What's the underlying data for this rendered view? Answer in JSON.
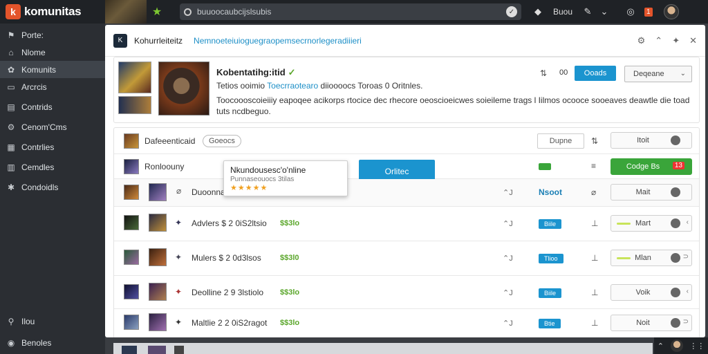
{
  "app": {
    "logo_letter": "k",
    "name": "komunitas"
  },
  "search": {
    "value": "buuoocaubcijslsubis",
    "clear": "✓"
  },
  "top_actions": [
    {
      "icon": "shield-icon",
      "glyph": "◆"
    },
    {
      "label": "Buou"
    },
    {
      "icon": "edit-icon",
      "glyph": "✎"
    },
    {
      "icon": "chevron-down-icon",
      "glyph": "⌄"
    },
    {
      "icon": "bell-icon",
      "glyph": "◎"
    }
  ],
  "notification_count": "1",
  "sidebar": {
    "items": [
      {
        "icon": "fire-icon",
        "glyph": "⚑",
        "label": "Porte:"
      },
      {
        "icon": "home-icon",
        "glyph": "⌂",
        "label": "Nlome"
      },
      {
        "icon": "community-icon",
        "glyph": "✿",
        "label": "Komunits"
      },
      {
        "icon": "archive-icon",
        "glyph": "▭",
        "label": "Arcrcis"
      },
      {
        "icon": "controls-icon",
        "glyph": "▤",
        "label": "Contrids"
      },
      {
        "icon": "games-icon",
        "glyph": "⚙",
        "label": "Cenom'Cms"
      },
      {
        "icon": "calendar-icon",
        "glyph": "▦",
        "label": "Contrlies"
      },
      {
        "icon": "templates-icon",
        "glyph": "▥",
        "label": "Cemdles"
      },
      {
        "icon": "settings-icon",
        "glyph": "✱",
        "label": "Condoidls"
      }
    ],
    "bottom": [
      {
        "icon": "pin-icon",
        "glyph": "⚲",
        "label": "Ilou"
      },
      {
        "icon": "help-icon",
        "glyph": "◉",
        "label": "Benoles"
      }
    ]
  },
  "panel": {
    "icon_text": "K",
    "title": "Kohurrleiteitz",
    "subtitle": "Nemnoeteiuioguegraopemsecrnorlegeradiiieri",
    "actions": [
      "⚙",
      "⌃",
      "✦",
      "✕"
    ]
  },
  "feature": {
    "title": "Kobentatihg:itid",
    "title_mark": "✓",
    "meta_prefix": "Tetios ooimio",
    "meta_link": "Toecrraotearo",
    "meta_rest": "diioooocs Toroas 0 Oritnles.",
    "description": "Toocoooscoieiiiy eapoqee acikorps rtocice dec rhecore oeoscioeicwes soieileme trags l Iilmos ocooce sooeaves deawtle die toad tuts ncdbeguo.",
    "share_glyph": "⇅",
    "count": "00",
    "primary_button": "Ooads",
    "dropdown_value": "Deqeane"
  },
  "rows": [
    {
      "name": "Dafeeenticaid",
      "pill": "Goeocs",
      "input": "Dupne",
      "action": "⇅",
      "toggle": "Itoit"
    },
    {
      "name": "Ronloouny",
      "toggle": "Codge Bs",
      "toggle_tail": "13",
      "action": "≡",
      "online_button": "Orlitec"
    },
    {
      "name": "Duoonnasadoi",
      "num": "⌃J",
      "version": "Nsoot",
      "action": "⌀",
      "toggle": "Mait"
    },
    {
      "name": "Advlers $ 2 0iS2ltsio",
      "price": "$$3lo",
      "num": "⌃J",
      "badge": "Biile",
      "action": "⊥",
      "toggle": "Mart",
      "tail": "‹"
    },
    {
      "name": "Mulers $ 2 0d3lsos",
      "price": "$$3l0",
      "num": "⌃J",
      "badge": "Tlioo",
      "action": "⊥",
      "toggle": "Mlan",
      "tail": "⊃"
    },
    {
      "name": "Deolline 2 9 3lstiolo",
      "price": "$$3lo",
      "num": "⌃J",
      "badge": "Biile",
      "action": "⊥",
      "toggle": "Voik",
      "tail": "‹"
    },
    {
      "name": "Maltlie 2 2 0iS2ragot",
      "price": "$$3lo",
      "num": "⌃J",
      "badge": "Btie",
      "action": "⊥",
      "toggle": "Noit",
      "tail": "⊃"
    }
  ],
  "popup": {
    "title": "Nkundousesc'o'nline",
    "subtitle": "Punnaseouocs 3tilas",
    "stars": "★★★★★"
  },
  "corner": {
    "glyph": "⌃"
  },
  "colors": {
    "accent": "#1b94cf",
    "brand": "#e3542b",
    "success": "#3aa53a",
    "price": "#5aa62a"
  }
}
